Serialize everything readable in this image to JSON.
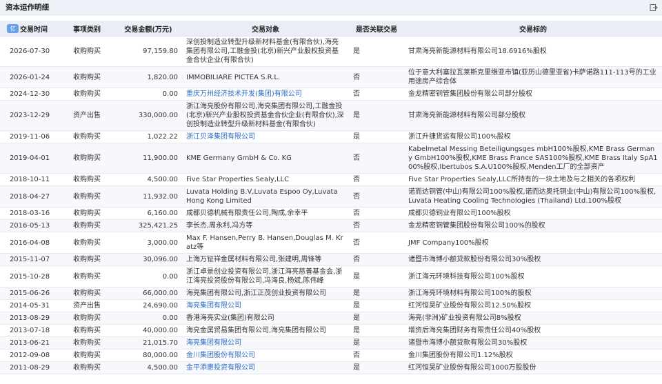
{
  "header": {
    "title": "资本运作明细"
  },
  "table": {
    "sort_badge": "亿",
    "columns": [
      "交易时间",
      "事项类别",
      "交易金额(万元)",
      "交易对象",
      "是否关联交易",
      "交易标的"
    ],
    "rows": [
      {
        "date": "2026-07-30",
        "category": "收购购买",
        "amount": "97,159.80",
        "party": "深创投制造业转型升级新材料基金(有限合伙),海亮集团有限公司,工融金投(北京)新兴产业股权投资基金合伙企业(有限合伙)",
        "party_link": false,
        "related": "是",
        "target": "甘肃海亮新能源材料有限公司18.6916%股权"
      },
      {
        "date": "2026-01-24",
        "category": "收购购买",
        "amount": "1,820.00",
        "party": "IMMOBILIARE PICTEA S.R.L.",
        "party_link": false,
        "related": "否",
        "target": "位于意大利塞拉瓦莱斯克里维亚市镇(亚历山德里亚省)卡萨诺路111-113号的工业用途房产综合体"
      },
      {
        "date": "2024-12-30",
        "category": "收购购买",
        "amount": "0.00",
        "party": "重庆万州经济技术开发(集团)有限公司",
        "party_link": true,
        "related": "否",
        "target": "金龙精密铜管集团股份有限公司部分股权"
      },
      {
        "date": "2023-12-29",
        "category": "资产出售",
        "amount": "330,000.00",
        "party": "浙江海亮股份有限公司,海亮集团有限公司,工融金投(北京)新兴产业股权投资基金合伙企业(有限合伙),深创投制造业转型升级新材料基金(有限合伙)",
        "party_link": false,
        "related": "是",
        "target": "甘肃海亮新能源材料有限公司部分股权"
      },
      {
        "date": "2019-11-06",
        "category": "收购购买",
        "amount": "1,022.22",
        "party": "浙江贝泽集团有限公司",
        "party_link": true,
        "related": "是",
        "target": "浙江升捷货运有限公司100%股权"
      },
      {
        "date": "2019-04-01",
        "category": "收购购买",
        "amount": "11,900.00",
        "party": "KME Germany GmbH & Co. KG",
        "party_link": false,
        "related": "否",
        "target": "Kabelmetal Messing Beteiligungsges mbH100%股权,KME Brass Germany GmbH100%股权,KME Brass France SAS100%股权,KME Brass Italy SpA100%股权,Ibertubos S.A.U100%股权,Menden工厂的全部资产"
      },
      {
        "date": "2018-10-11",
        "category": "收购购买",
        "amount": "4,500.00",
        "party": "Five Star Properties Sealy,LLC",
        "party_link": false,
        "related": "否",
        "target": "Five Star Properties Sealy,LLC所持有的一块土地及与之相关的各项权利"
      },
      {
        "date": "2018-04-27",
        "category": "收购购买",
        "amount": "11,932.00",
        "party": "Luvata Holding B.V,Luvata Espoo Oy,Luvata Hong Kong Limited",
        "party_link": false,
        "related": "否",
        "target": "诺而达铜管(中山)有限公司100%股权,诺而达奥托铜业(中山)有限公司100%股权,Luvata Heating Cooling Technologies (Thailand) Ltd.100%股权"
      },
      {
        "date": "2018-03-16",
        "category": "收购购买",
        "amount": "6,160.00",
        "party": "成都贝德机械有限责任公司,陶成,余幸平",
        "party_link": false,
        "related": "否",
        "target": "成都贝德铜业有限公司100%股权"
      },
      {
        "date": "2016-05-13",
        "category": "收购购买",
        "amount": "325,421.25",
        "party": "李长杰,周永利,冯方等",
        "party_link": false,
        "related": "否",
        "target": "金龙精密铜管集团股份有限公司100%的股权"
      },
      {
        "date": "2016-04-08",
        "category": "收购购买",
        "amount": "3,000.00",
        "party": "Max F. Hansen,Perry B. Hansen,Douglas M. Kratz等",
        "party_link": false,
        "related": "否",
        "target": "JMF Company100%股权"
      },
      {
        "date": "2015-11-07",
        "category": "收购购买",
        "amount": "30,096.00",
        "party": "上海万钲祥金属材料有限公司,张建明,周锋等",
        "party_link": false,
        "related": "否",
        "target": "诸暨市海博小额贷款股份有限公司30%股权"
      },
      {
        "date": "2015-10-28",
        "category": "收购购买",
        "amount": "0.00",
        "party": "浙江卓景创业投资有限公司,浙江海亮慈善基金会,浙江海亮投资股份有限公司,冯海良,杨斌,陈伟峰",
        "party_link": false,
        "related": "是",
        "target": "浙江海元环境科技有限公司100%股权"
      },
      {
        "date": "2015-06-26",
        "category": "收购购买",
        "amount": "66,000.00",
        "party": "海亮集团有限公司,浙江正茂创业投资有限公司",
        "party_link": false,
        "related": "是",
        "target": "浙江海亮环境材料有限公司100%的股权"
      },
      {
        "date": "2014-05-31",
        "category": "资产出售",
        "amount": "24,690.00",
        "party": "海亮集团有限公司",
        "party_link": true,
        "related": "是",
        "target": "红河恒昊矿业股份有限公司12.50%股权"
      },
      {
        "date": "2013-08-29",
        "category": "收购购买",
        "amount": "0.00",
        "party": "香港海亮实业(集团)有限公司",
        "party_link": false,
        "related": "是",
        "target": "海亮(非洲)矿业投资有限公司8%股权"
      },
      {
        "date": "2013-07-18",
        "category": "收购购买",
        "amount": "40,000.00",
        "party": "海亮金属贸易集团有限公司,海亮集团有限公司",
        "party_link": false,
        "related": "是",
        "target": "增资后海亮集团财务有限责任公司40%股权"
      },
      {
        "date": "2013-06-21",
        "category": "收购购买",
        "amount": "21,015.70",
        "party": "海亮集团有限公司",
        "party_link": true,
        "related": "是",
        "target": "诸暨市海博小额贷款有限公司30%股权"
      },
      {
        "date": "2012-09-08",
        "category": "收购购买",
        "amount": "80,000.00",
        "party": "金川集团股份有限公司",
        "party_link": true,
        "related": "否",
        "target": "金川集团股份有限公司1.12%股权"
      },
      {
        "date": "2011-08-29",
        "category": "收购购买",
        "amount": "4,500.00",
        "party": "金平添惠投资有限公司",
        "party_link": true,
        "related": "是",
        "target": "红河恒昊矿业股份有限公司1000万股股份"
      }
    ]
  }
}
